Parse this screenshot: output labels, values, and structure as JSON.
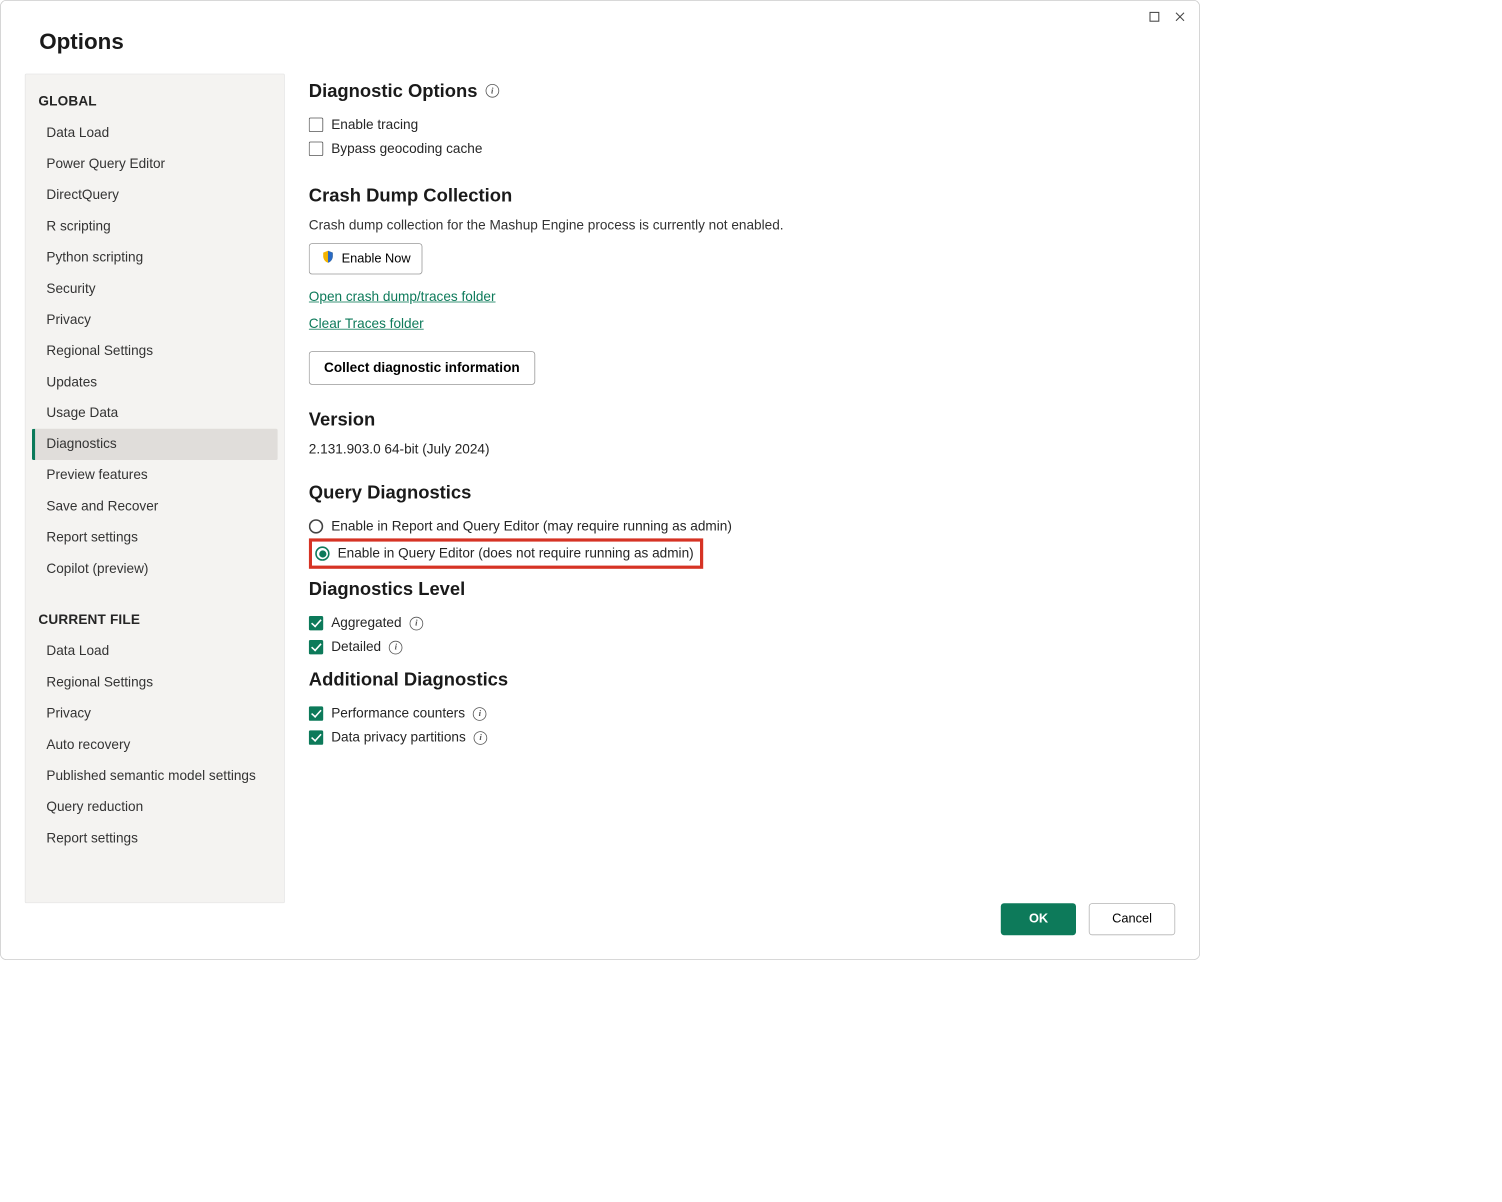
{
  "dialog": {
    "title": "Options"
  },
  "titlebar": {
    "maximize": "Maximize",
    "close": "Close"
  },
  "sidebar": {
    "section1_header": "GLOBAL",
    "global_items": [
      "Data Load",
      "Power Query Editor",
      "DirectQuery",
      "R scripting",
      "Python scripting",
      "Security",
      "Privacy",
      "Regional Settings",
      "Updates",
      "Usage Data",
      "Diagnostics",
      "Preview features",
      "Save and Recover",
      "Report settings",
      "Copilot (preview)"
    ],
    "global_selected_index": 10,
    "section2_header": "CURRENT FILE",
    "file_items": [
      "Data Load",
      "Regional Settings",
      "Privacy",
      "Auto recovery",
      "Published semantic model settings",
      "Query reduction",
      "Report settings"
    ]
  },
  "diagnostic_options": {
    "title": "Diagnostic Options",
    "enable_tracing": "Enable tracing",
    "bypass_geo": "Bypass geocoding cache"
  },
  "crash_dump": {
    "title": "Crash Dump Collection",
    "desc": "Crash dump collection for the Mashup Engine process is currently not enabled.",
    "enable_now": "Enable Now",
    "link_open": "Open crash dump/traces folder",
    "link_clear": "Clear Traces folder",
    "collect_btn": "Collect diagnostic information"
  },
  "version": {
    "title": "Version",
    "value": "2.131.903.0 64-bit (July 2024)"
  },
  "query_diag": {
    "title": "Query Diagnostics",
    "opt1": "Enable in Report and Query Editor (may require running as admin)",
    "opt2": "Enable in Query Editor (does not require running as admin)"
  },
  "diag_level": {
    "title": "Diagnostics Level",
    "aggregated": "Aggregated",
    "detailed": "Detailed"
  },
  "additional": {
    "title": "Additional Diagnostics",
    "perf": "Performance counters",
    "privacy": "Data privacy partitions"
  },
  "footer": {
    "ok": "OK",
    "cancel": "Cancel"
  }
}
